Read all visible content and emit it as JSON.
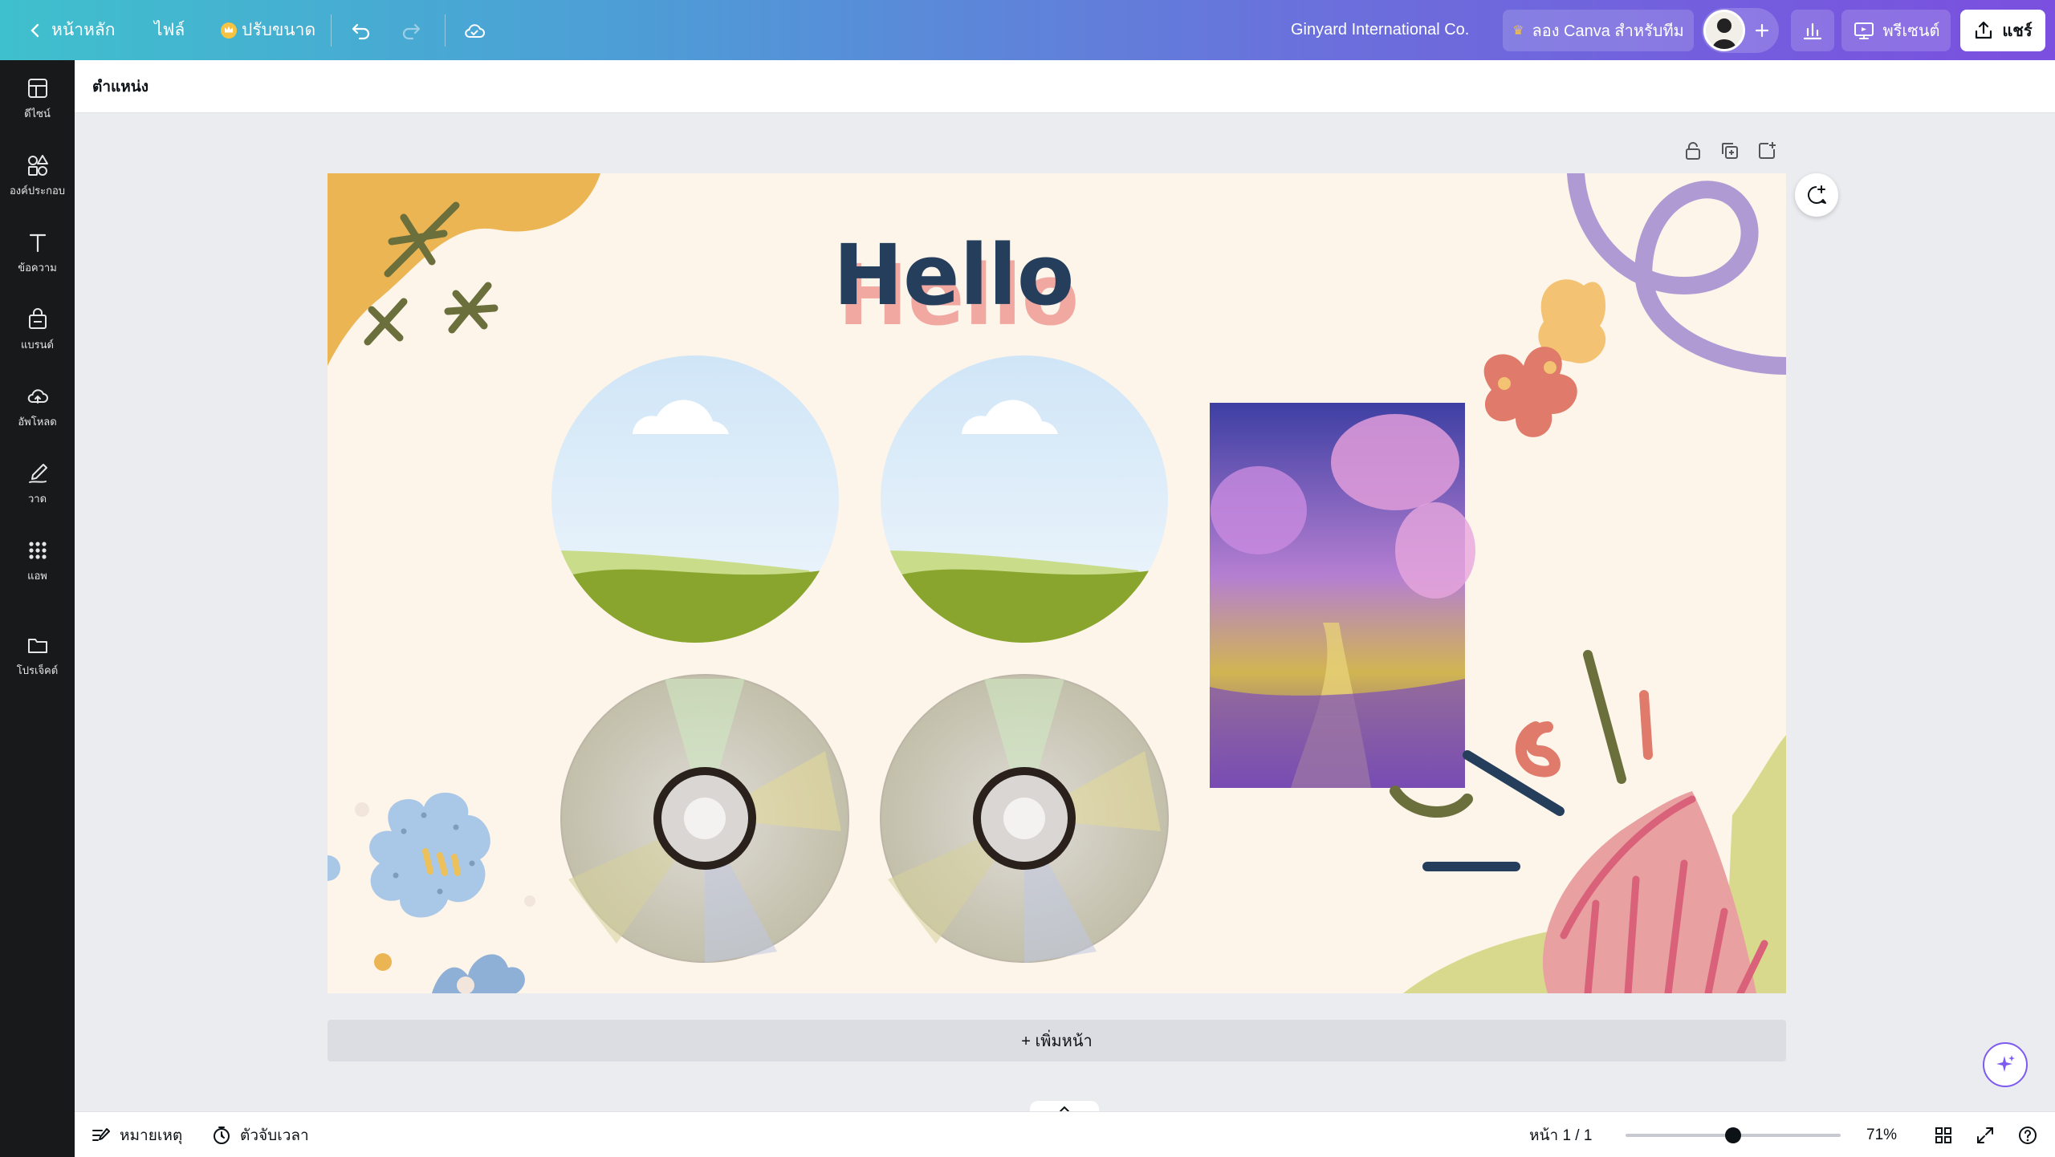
{
  "topbar": {
    "home_label": "หน้าหลัก",
    "file_label": "ไฟล์",
    "resize_label": "ปรับขนาด",
    "team_name": "Ginyard International Co.",
    "try_canva_label": "ลอง Canva สำหรับทีม",
    "present_label": "พรีเซนต์",
    "share_label": "แชร์"
  },
  "rail": {
    "items": [
      {
        "label": "ดีไซน์",
        "icon": "design-icon"
      },
      {
        "label": "องค์ประกอบ",
        "icon": "elements-icon"
      },
      {
        "label": "ข้อความ",
        "icon": "text-icon"
      },
      {
        "label": "แบรนด์",
        "icon": "brand-icon"
      },
      {
        "label": "อัพโหลด",
        "icon": "upload-icon"
      },
      {
        "label": "วาด",
        "icon": "draw-icon"
      },
      {
        "label": "แอพ",
        "icon": "apps-icon"
      },
      {
        "label": "โปรเจ็คต์",
        "icon": "projects-icon"
      }
    ]
  },
  "context_bar": {
    "position_label": "ตำแหน่ง"
  },
  "canvas": {
    "heading": "Hello"
  },
  "add_page_label": "+ เพิ่มหน้า",
  "bottombar": {
    "notes_label": "หมายเหตุ",
    "timer_label": "ตัวจับเวลา",
    "page_indicator": "หน้า 1 / 1",
    "zoom_level": "71%",
    "zoom_fraction": 0.5
  },
  "colors": {
    "topbar_start": "#3fc0cd",
    "topbar_end": "#7b4fdf",
    "rail_bg": "#18191b",
    "canvas_bg": "#fdf4ea",
    "heading_color": "#253e5c",
    "heading_shadow": "#f0a8a0"
  }
}
